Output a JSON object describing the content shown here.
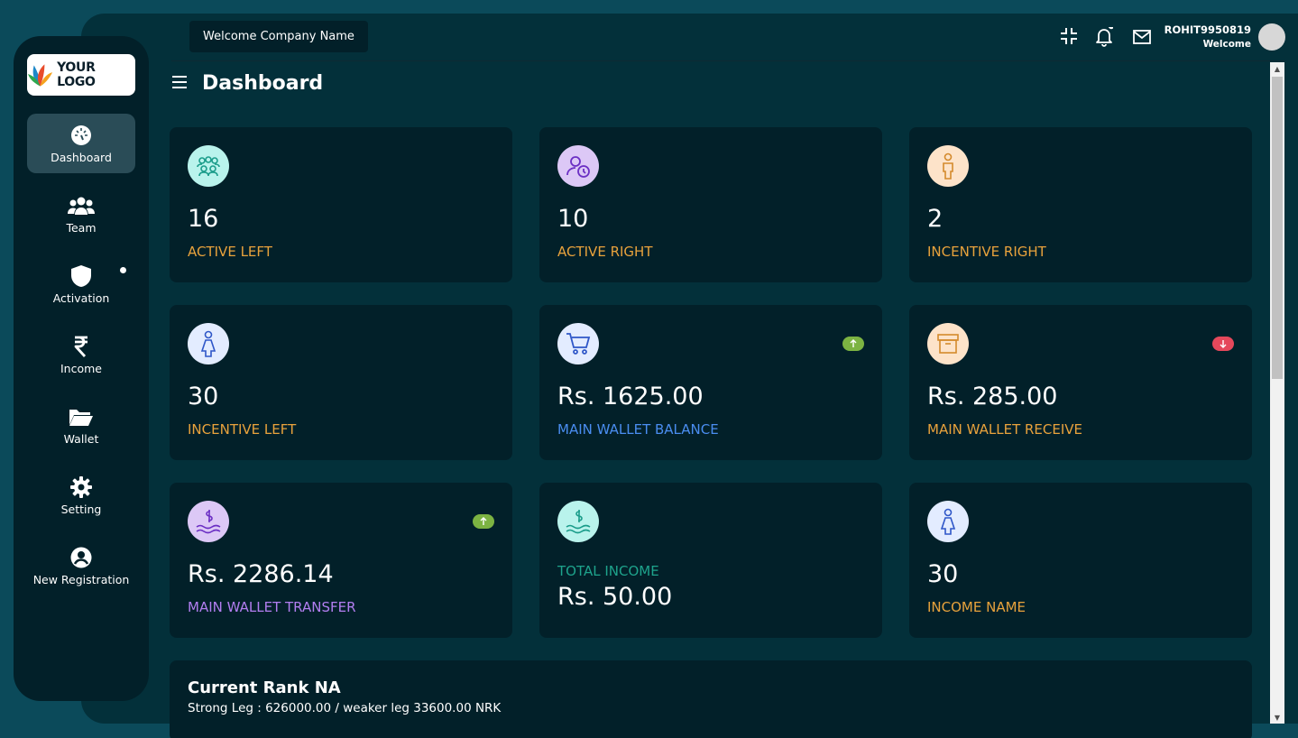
{
  "header": {
    "welcome": "Welcome Company Name",
    "username": "ROHIT9950819",
    "user_sub": "Welcome"
  },
  "logo": {
    "text": "YOUR LOGO"
  },
  "sidebar": {
    "items": [
      {
        "label": "Dashboard",
        "icon": "dashboard-gauge-icon",
        "active": true
      },
      {
        "label": "Team",
        "icon": "team-icon"
      },
      {
        "label": "Activation",
        "icon": "shield-icon",
        "has_dot": true
      },
      {
        "label": "Income",
        "icon": "rupee-icon"
      },
      {
        "label": "Wallet",
        "icon": "folder-icon"
      },
      {
        "label": "Setting",
        "icon": "gear-icon"
      },
      {
        "label": "New Registration",
        "icon": "user-circle-icon"
      }
    ]
  },
  "page": {
    "title": "Dashboard"
  },
  "cards": [
    {
      "value": "16",
      "label": "ACTIVE LEFT",
      "label_color": "#e8a23c",
      "icon": "group-icon",
      "icon_bg": "#b9f3ec"
    },
    {
      "value": "10",
      "label": "ACTIVE RIGHT",
      "label_color": "#e8a23c",
      "icon": "user-clock-icon",
      "icon_bg": "#dcc8f6"
    },
    {
      "value": "2",
      "label": "INCENTIVE RIGHT",
      "label_color": "#e8a23c",
      "icon": "person-icon",
      "icon_bg": "#fde3c9"
    },
    {
      "value": "30",
      "label": "INCENTIVE LEFT",
      "label_color": "#e8a23c",
      "icon": "woman-icon",
      "icon_bg": "#e3ecff"
    },
    {
      "value": "Rs. 1625.00",
      "label": "MAIN WALLET BALANCE",
      "label_color": "#4a8df0",
      "icon": "cart-icon",
      "icon_bg": "#e3ecff",
      "badge": "up"
    },
    {
      "value": "Rs. 285.00",
      "label": "MAIN WALLET RECEIVE",
      "label_color": "#e8a23c",
      "icon": "box-icon",
      "icon_bg": "#fde3c9",
      "badge": "down"
    },
    {
      "value": "Rs. 2286.14",
      "label": "MAIN WALLET TRANSFER",
      "label_color": "#b27ef0",
      "icon": "money-hand-icon",
      "icon_bg": "#dcc8f6",
      "badge": "up"
    },
    {
      "value": "Rs. 50.00",
      "label": "TOTAL INCOME",
      "label_color": "#1ea38c",
      "icon": "money-hand-icon",
      "icon_bg": "#b9f3ec",
      "label_above": true
    },
    {
      "value": "30",
      "label": "INCOME NAME",
      "label_color": "#e8a23c",
      "icon": "woman-icon",
      "icon_bg": "#e3ecff"
    }
  ],
  "rank": {
    "title": "Current Rank NA",
    "subtitle": "Strong Leg : 626000.00 / weaker leg 33600.00 NRK"
  },
  "colors": {
    "background": "#0b4a5a",
    "panel": "#03303a",
    "card": "#022029",
    "badge_up": "#7cb342",
    "badge_down": "#e5485b"
  }
}
